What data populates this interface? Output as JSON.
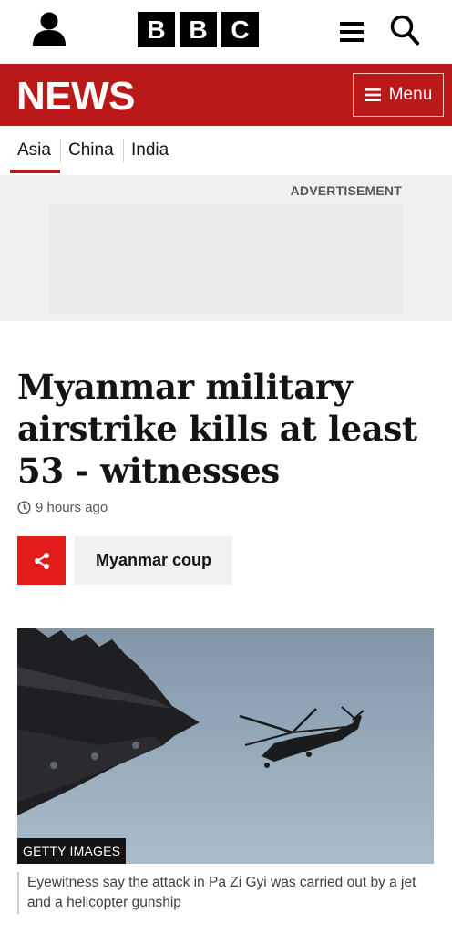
{
  "header": {
    "logo": [
      "B",
      "B",
      "C"
    ],
    "icons": {
      "account": "user-icon",
      "menu": "hamburger-icon",
      "search": "search-icon"
    }
  },
  "banner": {
    "title": "NEWS",
    "menu_label": "Menu",
    "color": "#bb1919"
  },
  "subnav": {
    "items": [
      {
        "label": "Asia",
        "active": true
      },
      {
        "label": "China",
        "active": false
      },
      {
        "label": "India",
        "active": false
      }
    ]
  },
  "advert": {
    "label": "ADVERTISEMENT"
  },
  "article": {
    "headline": "Myanmar military airstrike kills at least 53 - witnesses",
    "timestamp": "9 hours ago",
    "topic": "Myanmar coup",
    "share_icon": "share-icon",
    "share_color": "#e31b1b",
    "image": {
      "credit": "GETTY IMAGES",
      "caption": "Eyewitness say the attack in Pa Zi Gyi was carried out by a jet and a helicopter gunship"
    }
  }
}
